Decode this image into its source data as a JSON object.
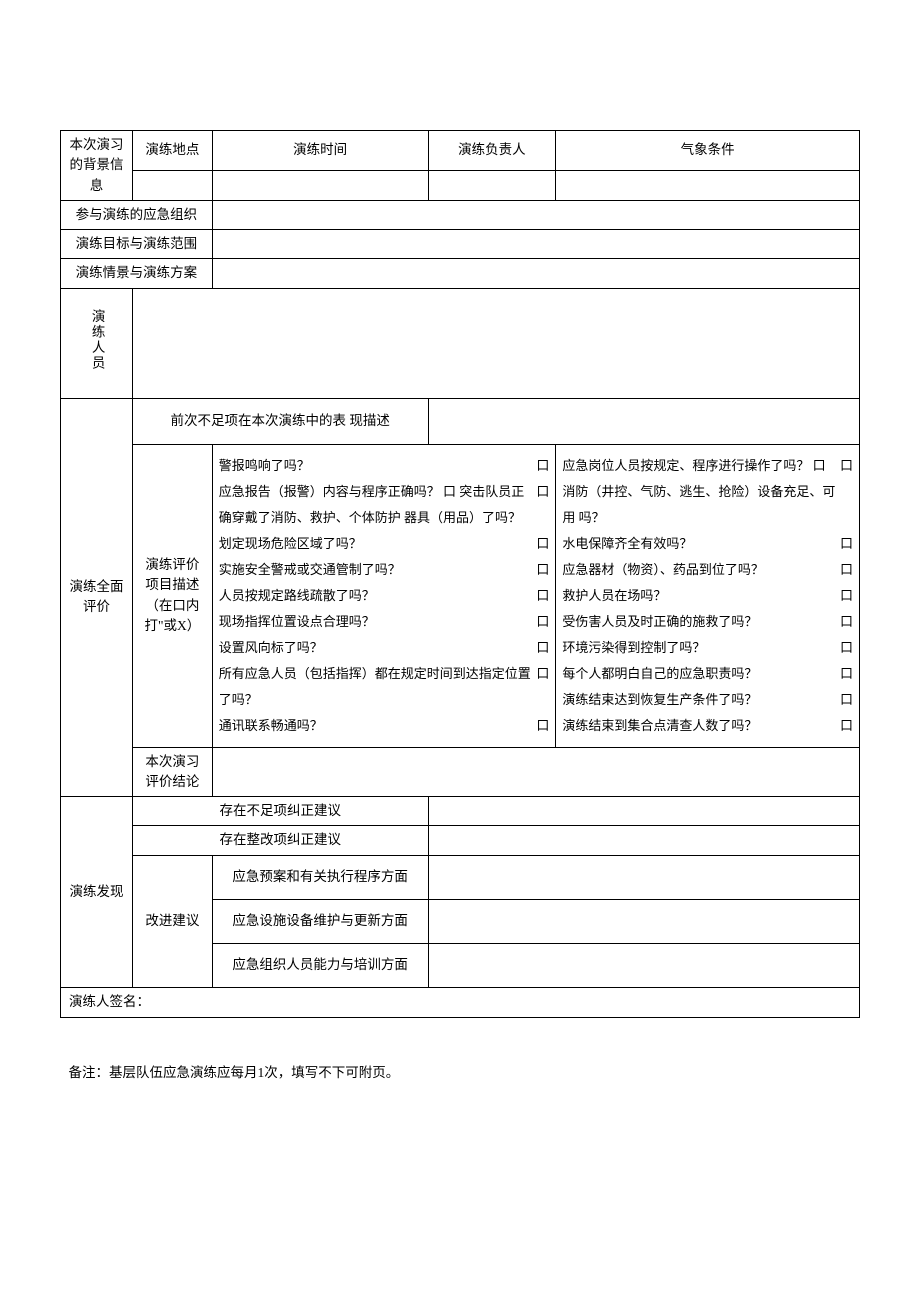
{
  "header": {
    "bg_info": "本次演习的背景信息",
    "loc": "演练地点",
    "time": "演练时间",
    "leader": "演练负责人",
    "weather": "气象条件"
  },
  "rows": {
    "org": "参与演练的应急组织",
    "goal": "演练目标与演练范围",
    "scene": "演练情景与演练方案",
    "personnel": "演练人员"
  },
  "eval": {
    "section": "演练全面评价",
    "prev": "前次不足项在本次演练中的表 现描述",
    "desc_label": "演练评价项目描述（在口内打\"或X）",
    "left_items": [
      "警报鸣响了吗？",
      "应急报告（报警）内容与程序正确吗？ 口 突击队员正确穿戴了消防、救护、个体防护 器具（用品）了吗？",
      "划定现场危险区域了吗？",
      "实施安全警戒或交通管制了吗？",
      "人员按规定路线疏散了吗？",
      "现场指挥位置设点合理吗？",
      "设置风向标了吗？",
      "所有应急人员（包括指挥）都在规定时间到达指定位置了吗？",
      "通讯联系畅通吗？"
    ],
    "right_items": [
      "应急岗位人员按规定、程序进行操作了吗？ 口 消防（井控、气防、逃生、抢险）设备充足、可用 吗？",
      "水电保障齐全有效吗？",
      "应急器材（物资）、药品到位了吗？",
      "救护人员在场吗？",
      "受伤害人员及时正确的施救了吗？",
      "环境污染得到控制了吗？",
      "每个人都明白自己的应急职责吗？",
      "演练结束达到恢复生产条件了吗？",
      "演练结束到集合点清查人数了吗？"
    ],
    "conclusion": "本次演习评价结论"
  },
  "findings": {
    "section": "演练发现",
    "deficiency": "存在不足项纠正建议",
    "rectify": "存在整改项纠正建议",
    "improve": "改进建议",
    "aspect1": "应急预案和有关执行程序方面",
    "aspect2": "应急设施设备维护与更新方面",
    "aspect3": "应急组织人员能力与培训方面"
  },
  "signature": "演练人签名：",
  "note": "备注：基层队伍应急演练应每月1次，填写不下可附页。",
  "box": "口"
}
